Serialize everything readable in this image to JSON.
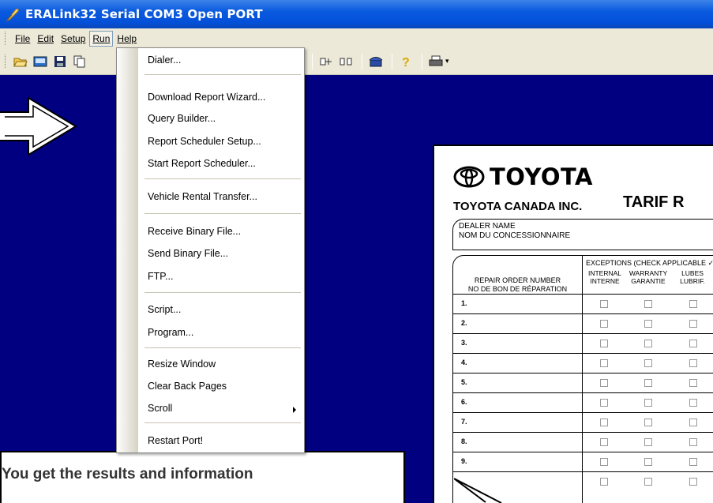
{
  "window": {
    "title": "ERALink32 Serial COM3 Open PORT"
  },
  "menubar": {
    "items": [
      {
        "label": "File",
        "mnemonic": "F"
      },
      {
        "label": "Edit",
        "mnemonic": "E"
      },
      {
        "label": "Setup",
        "mnemonic": "S"
      },
      {
        "label": "Run",
        "mnemonic": "R"
      },
      {
        "label": "Help",
        "mnemonic": "H"
      }
    ],
    "active": "Run"
  },
  "toolbar": {
    "icons": [
      "open-folder-icon",
      "terminal-icon",
      "save-icon",
      "copy-icon",
      "upload-icon",
      "download-icon",
      "connect-icon",
      "disconnect-icon",
      "phone-icon",
      "help-icon",
      "print-icon"
    ]
  },
  "run_menu": {
    "items": [
      {
        "label": "Dialer...",
        "mnemonic": "D"
      },
      {
        "label": "Download Report Wizard...",
        "mnemonic": "W"
      },
      {
        "label": "Query Builder...",
        "mnemonic": "Q"
      },
      {
        "label": "Report Scheduler Setup...",
        "mnemonic": "h"
      },
      {
        "label": "Start Report Scheduler...",
        "mnemonic": "t"
      },
      {
        "label": "Vehicle Rental Transfer...",
        "mnemonic": "V"
      },
      {
        "label": "Receive Binary File...",
        "mnemonic": "R"
      },
      {
        "label": "Send Binary File...",
        "mnemonic": "S"
      },
      {
        "label": "FTP...",
        "mnemonic": "F"
      },
      {
        "label": "Script...",
        "mnemonic": "t"
      },
      {
        "label": "Program...",
        "mnemonic": "m"
      },
      {
        "label": "Resize Window",
        "mnemonic": "R"
      },
      {
        "label": "Clear Back Pages",
        "mnemonic": "C"
      },
      {
        "label": "Scroll",
        "mnemonic": "l"
      },
      {
        "label": "Restart Port!",
        "mnemonic": "P"
      }
    ]
  },
  "toyota_form": {
    "brand": "TOYOTA",
    "company": "TOYOTA CANADA INC.",
    "heading": "TARIF R",
    "dealer_line1": "DEALER NAME",
    "dealer_line2": "NOM DU CONCESSIONNAIRE",
    "ro_head_en": "REPAIR ORDER NUMBER",
    "ro_head_fr": "NO DE BON DE RÉPARATION",
    "exceptions_head": "EXCEPTIONS (CHECK APPLICABLE ✓",
    "columns": [
      {
        "en": "INTERNAL",
        "fr": "INTERNE"
      },
      {
        "en": "WARRANTY",
        "fr": "GARANTIE"
      },
      {
        "en": "LUBES",
        "fr": "LUBRIF."
      }
    ],
    "rows": [
      "1.",
      "2.",
      "3.",
      "4.",
      "5.",
      "6.",
      "7.",
      "8.",
      "9."
    ]
  },
  "callout": {
    "text": "You get the results and information"
  }
}
